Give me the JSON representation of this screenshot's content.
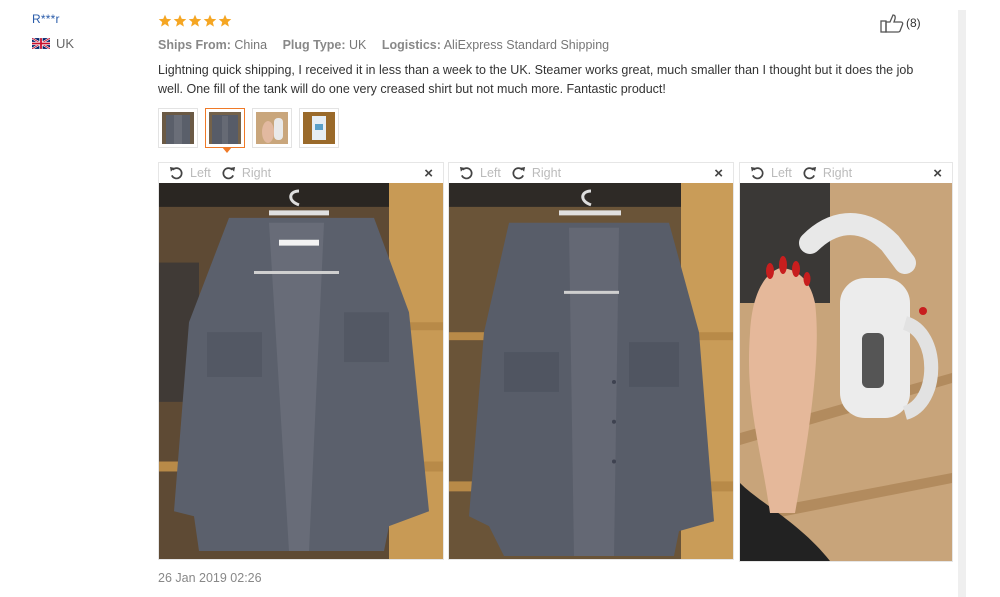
{
  "user": {
    "name": "R***r",
    "country": "UK"
  },
  "review": {
    "rating": 5,
    "like_count": "(8)",
    "meta": [
      {
        "label": "Ships From:",
        "value": "China"
      },
      {
        "label": "Plug Type:",
        "value": "UK"
      },
      {
        "label": "Logistics:",
        "value": "AliExpress Standard Shipping"
      }
    ],
    "text": "Lightning quick shipping, I received it in less than a week to the UK. Steamer works great, much smaller than I thought but it does the job well. One fill of the tank will do one very creased shirt but not much more. Fantastic product!",
    "date": "26 Jan 2019 02:26"
  },
  "viewer": {
    "left_label": "Left",
    "right_label": "Right",
    "close_label": "×"
  },
  "colors": {
    "star": "#f5a623",
    "accent": "#ef7a28",
    "user_link": "#2a5caa"
  }
}
